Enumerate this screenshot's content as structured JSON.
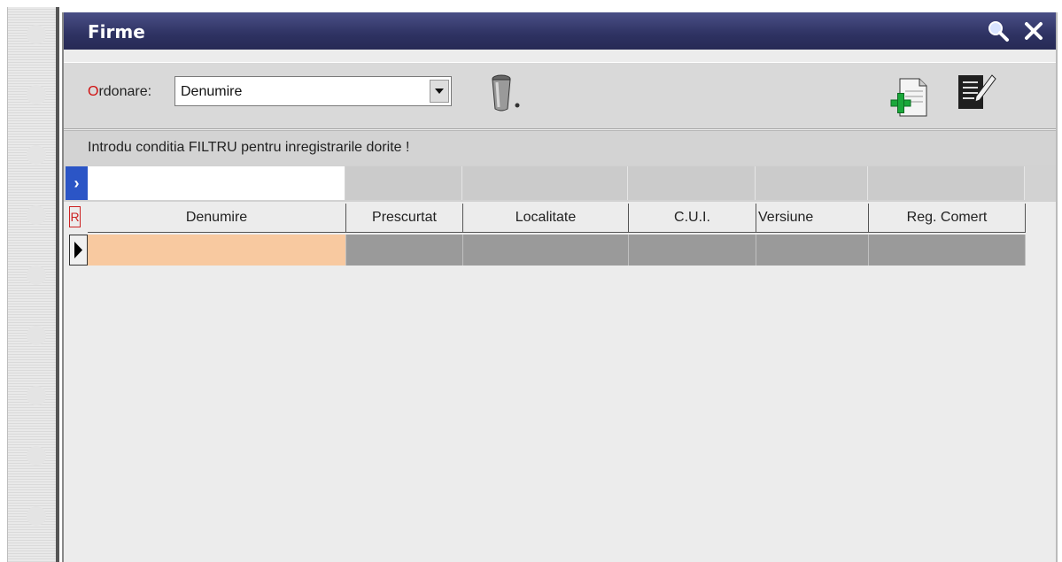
{
  "window": {
    "title": "Firme",
    "search_icon": "search-icon",
    "close_icon": "close-icon"
  },
  "toolbar": {
    "ordonare_first_letter": "O",
    "ordonare_rest": "rdonare:",
    "sort_value": "Denumire",
    "icons": [
      "dropdown-arrow-icon",
      "trash-icon",
      "add-document-icon",
      "edit-document-icon"
    ]
  },
  "filter": {
    "hint": "Introdu conditia FILTRU pentru inregistrarile dorite !",
    "marker": "›",
    "value": ""
  },
  "grid": {
    "r_badge": "R",
    "sort_glyph": "⬍",
    "columns": [
      "Denumire",
      "Prescurtat",
      "Localitate",
      "C.U.I.",
      "Versiune",
      "Reg. Comert"
    ],
    "rows": [
      [
        "",
        "",
        "",
        "",
        "",
        ""
      ]
    ]
  },
  "colors": {
    "titlebar": "#2e3262",
    "selected_cell": "#f8c9a0",
    "filter_marker": "#2b55c6"
  }
}
